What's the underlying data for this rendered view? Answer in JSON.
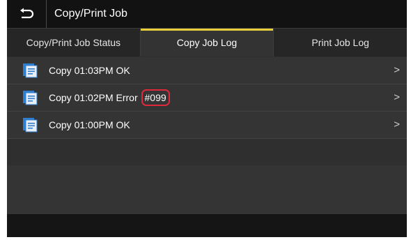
{
  "header": {
    "title": "Copy/Print Job",
    "back_icon": "back-arrow-icon"
  },
  "tabs": [
    {
      "label": "Copy/Print Job Status",
      "active": false
    },
    {
      "label": "Copy Job Log",
      "active": true
    },
    {
      "label": "Print Job Log",
      "active": false
    }
  ],
  "jobs": [
    {
      "text": "Copy 01:03PM OK",
      "error_code": "",
      "chevron": ">"
    },
    {
      "text": "Copy 01:02PM Error ",
      "error_code": "#099",
      "chevron": ">"
    },
    {
      "text": "Copy 01:00PM OK",
      "error_code": "",
      "chevron": ">"
    }
  ],
  "colors": {
    "accent_tab": "#e8cf3a",
    "highlight_ring": "#e0283a",
    "icon_blue": "#2f7fd0"
  }
}
